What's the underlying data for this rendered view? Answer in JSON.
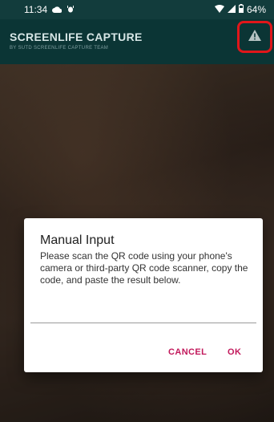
{
  "status_bar": {
    "time": "11:34",
    "battery": "64%",
    "icons": [
      "cloud-icon",
      "bug-icon",
      "wifi-icon",
      "signal-icon",
      "battery-icon"
    ]
  },
  "app_bar": {
    "title": "SCREENLIFE CAPTURE",
    "subtitle": "BY SUTD SCREENLIFE CAPTURE TEAM",
    "action_icon": "warning-icon"
  },
  "dialog": {
    "title": "Manual Input",
    "message": "Please scan the QR code using your phone's camera or third-party QR code scanner, copy the code, and paste the result below.",
    "input_value": "",
    "cancel_label": "CANCEL",
    "ok_label": "OK"
  },
  "colors": {
    "app_bar": "#0b3535",
    "status_bar": "#123c3c",
    "accent": "#c2185b",
    "highlight": "#e0161a"
  }
}
